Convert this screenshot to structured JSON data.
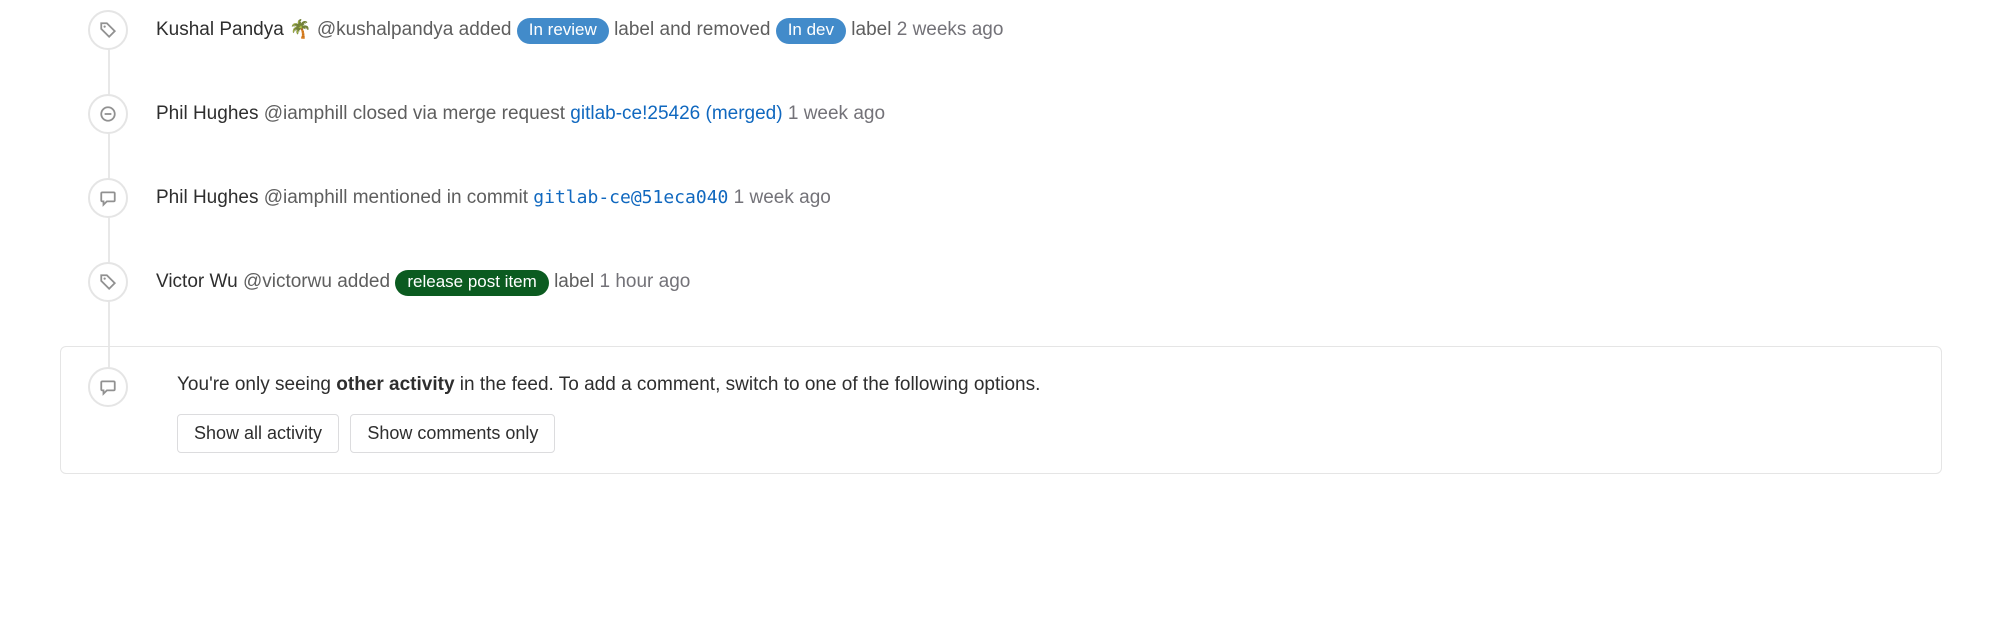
{
  "events": [
    {
      "author": "Kushal Pandya",
      "emoji": "🌴",
      "handle": "@kushalpandya",
      "pre1": "added",
      "label1": "In review",
      "mid": "label and removed",
      "label2": "In dev",
      "post": "label",
      "time": "2 weeks ago"
    },
    {
      "author": "Phil Hughes",
      "handle": "@iamphill",
      "action": "closed via merge request",
      "link": "gitlab-ce!25426 (merged)",
      "time": "1 week ago"
    },
    {
      "author": "Phil Hughes",
      "handle": "@iamphill",
      "action": "mentioned in commit",
      "codelink": "gitlab-ce@51eca040",
      "time": "1 week ago"
    },
    {
      "author": "Victor Wu",
      "handle": "@victorwu",
      "pre1": "added",
      "label1": "release post item",
      "post": "label",
      "time": "1 hour ago"
    }
  ],
  "footer": {
    "t1": "You're only seeing ",
    "t2": "other activity",
    "t3": " in the feed. To add a comment, switch to one of the following options.",
    "btn1": "Show all activity",
    "btn2": "Show comments only"
  }
}
